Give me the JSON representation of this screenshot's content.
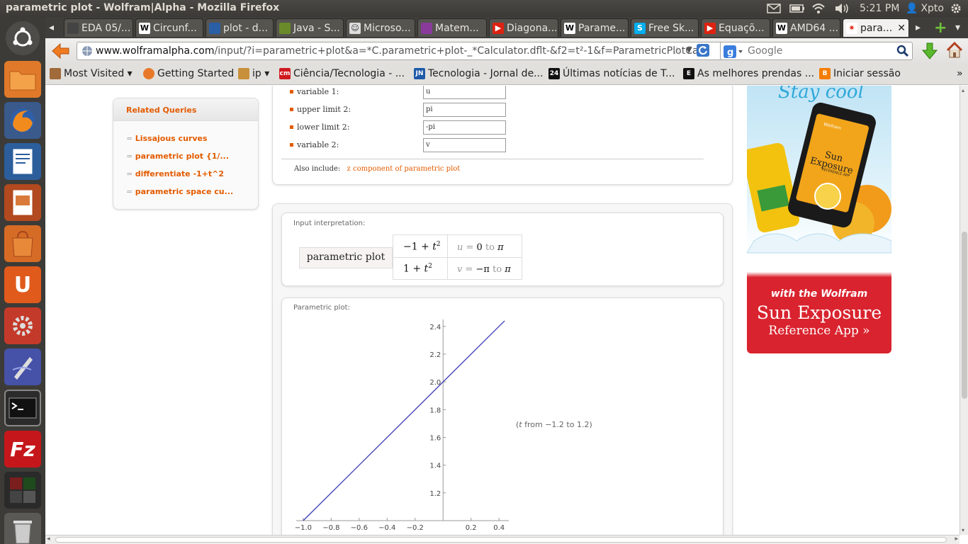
{
  "window": {
    "title": "parametric plot - Wolfram|Alpha - Mozilla Firefox",
    "clock": "5:21 PM",
    "user": "Xpto"
  },
  "tabs": [
    {
      "label": "EDA 05/..."
    },
    {
      "label": "Circunf..."
    },
    {
      "label": "plot - d..."
    },
    {
      "label": "Java - S..."
    },
    {
      "label": "Microso..."
    },
    {
      "label": "Matem..."
    },
    {
      "label": "Diagona..."
    },
    {
      "label": "Parame..."
    },
    {
      "label": "Free Sk..."
    },
    {
      "label": "Equaçõ..."
    },
    {
      "label": "AMD64 ..."
    },
    {
      "label": "para..."
    }
  ],
  "nav": {
    "url_host": "www.wolframalpha.com",
    "url_path": "/input/?i=parametric+plot&a=*C.parametric+plot-_*Calculator.dflt-&f2=t²-1&f=ParametricPlotCa",
    "search_placeholder": "Google"
  },
  "bookmarks": [
    {
      "label": "Most Visited ▾"
    },
    {
      "label": "Getting Started"
    },
    {
      "label": "ip ▾"
    },
    {
      "label": "Ciência/Tecnologia - ..."
    },
    {
      "label": "Tecnologia - Jornal de..."
    },
    {
      "label": "Últimas notícias de T..."
    },
    {
      "label": "As melhores prendas ..."
    },
    {
      "label": "Iniciar sessão"
    }
  ],
  "related": {
    "heading": "Related Queries",
    "items": [
      {
        "label": "Lissajous curves"
      },
      {
        "label": "parametric plot {1/..."
      },
      {
        "label": "differentiate -1+t^2"
      },
      {
        "label": "parametric space cu..."
      }
    ]
  },
  "params": [
    {
      "label": "variable 1:",
      "value": "u"
    },
    {
      "label": "upper limit 2:",
      "value": "pi"
    },
    {
      "label": "lower limit 2:",
      "value": "-pi"
    },
    {
      "label": "variable 2:",
      "value": "v"
    }
  ],
  "also_include": {
    "label": "Also include:",
    "link": "z component of parametric plot"
  },
  "interpretation": {
    "heading": "Input interpretation:",
    "name": "parametric plot",
    "row1_expr_a": "−1 + ",
    "row1_expr_b": "t",
    "row1_exp": "2",
    "row1_range_var": "u",
    "row1_range_eq": " = ",
    "row1_range_from": "0",
    "row1_range_to": " to ",
    "row1_range_end": "π",
    "row2_expr_a": "1 + ",
    "row2_expr_b": "t",
    "row2_exp": "2",
    "row2_range_var": "v",
    "row2_range_eq": " = ",
    "row2_range_from": "−π",
    "row2_range_to": " to ",
    "row2_range_end": "π"
  },
  "plot": {
    "heading": "Parametric plot:",
    "note_var": "t",
    "note_rest": " from −1.2 to 1.2)",
    "note_open": "("
  },
  "chart_data": {
    "type": "line",
    "series": [
      {
        "x": [
          -1.0,
          0.44
        ],
        "y": [
          1.0,
          2.44
        ]
      }
    ],
    "xlim": [
      -1.05,
      0.47
    ],
    "ylim": [
      1.0,
      2.45
    ],
    "xticks": [
      "−1.0",
      "−0.8",
      "−0.6",
      "−0.4",
      "−0.2",
      "0.2",
      "0.4"
    ],
    "xtick_values": [
      -1.0,
      -0.8,
      -0.6,
      -0.4,
      -0.2,
      0.2,
      0.4
    ],
    "yticks": [
      "1.2",
      "1.4",
      "1.6",
      "1.8",
      "2.0",
      "2.2",
      "2.4"
    ],
    "ytick_values": [
      1.2,
      1.4,
      1.6,
      1.8,
      2.0,
      2.2,
      2.4
    ],
    "line_color": "#3b3bb5",
    "grid": false
  },
  "ad": {
    "top_text": "Stay cool",
    "line1": "with the Wolfram",
    "line2": "Sun Exposure",
    "line3": "Reference App »",
    "phone_title": "Sun Exposure",
    "phone_sub": "REFERENCE APP",
    "brand": "Wolfram"
  },
  "colors": {
    "accent": "#e35b00",
    "ad_red": "#d9232e"
  }
}
